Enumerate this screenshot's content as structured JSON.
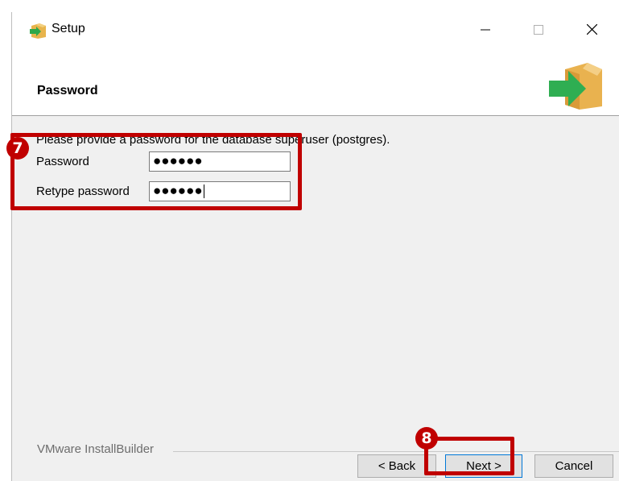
{
  "window": {
    "title": "Setup",
    "minimize_glyph": "—",
    "maximize_glyph": "☐",
    "close_glyph": "✕"
  },
  "header": {
    "title": "Password",
    "icon": "installer-box-arrow-icon"
  },
  "content": {
    "prompt": "Please provide a password for the database superuser (postgres).",
    "password_label": "Password",
    "password_value": "●●●●●●",
    "retype_label": "Retype password",
    "retype_value": "●●●●●●"
  },
  "annotations": {
    "step_fields": "7",
    "step_next": "8",
    "highlight_color": "#c00000"
  },
  "footer": {
    "brand": "VMware InstallBuilder",
    "back_label": "< Back",
    "next_label": "Next >",
    "cancel_label": "Cancel"
  }
}
